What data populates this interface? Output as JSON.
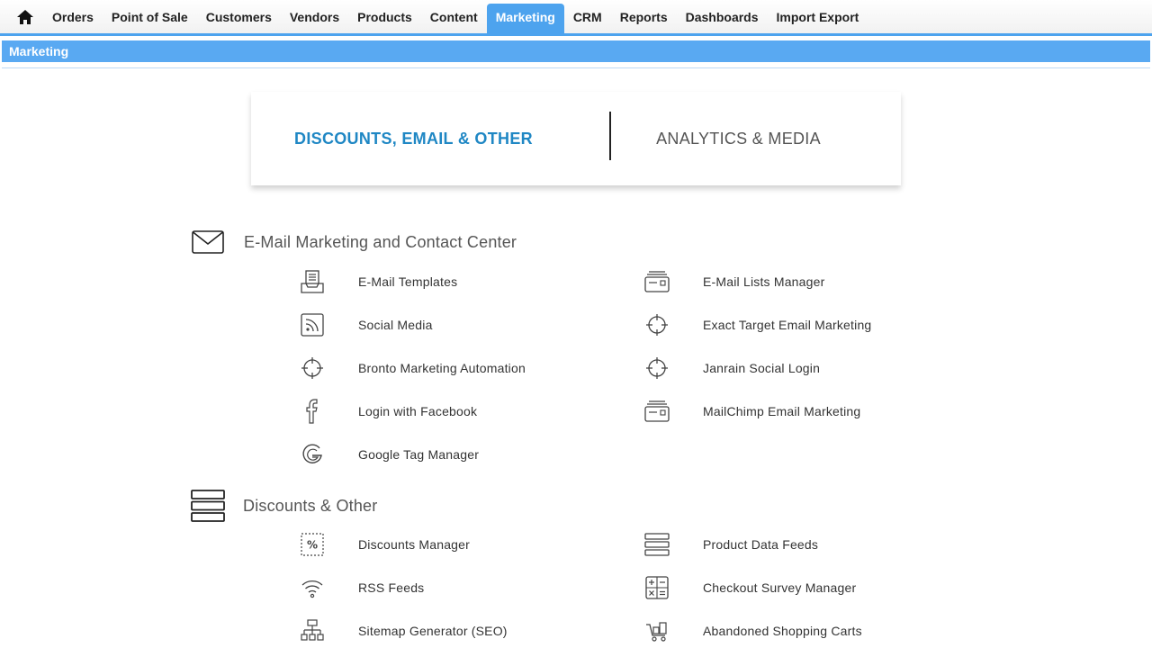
{
  "nav": {
    "items": [
      {
        "label": "Orders"
      },
      {
        "label": "Point of Sale"
      },
      {
        "label": "Customers"
      },
      {
        "label": "Vendors"
      },
      {
        "label": "Products"
      },
      {
        "label": "Content"
      },
      {
        "label": "Marketing",
        "active": true
      },
      {
        "label": "CRM"
      },
      {
        "label": "Reports"
      },
      {
        "label": "Dashboards"
      },
      {
        "label": "Import Export"
      }
    ],
    "home_icon": "home-icon",
    "accent": "#4da3ee"
  },
  "breadcrumb": {
    "title": "Marketing"
  },
  "tabs": {
    "active_label": "DISCOUNTS, EMAIL & OTHER",
    "other_label": "ANALYTICS & MEDIA",
    "active_color": "#1f87c4"
  },
  "sections": {
    "email": {
      "title": "E-Mail Marketing and Contact Center",
      "icon": "envelope-icon",
      "left": [
        {
          "label": "E-Mail Templates",
          "icon": "inbox-tray-icon"
        },
        {
          "label": "Social Media",
          "icon": "rss-icon"
        },
        {
          "label": "Bronto Marketing Automation",
          "icon": "crosshair-icon"
        },
        {
          "label": "Login with Facebook",
          "icon": "facebook-icon"
        },
        {
          "label": "Google Tag Manager",
          "icon": "google-icon"
        }
      ],
      "right": [
        {
          "label": "E-Mail Lists Manager",
          "icon": "mail-stack-icon"
        },
        {
          "label": "Exact Target Email Marketing",
          "icon": "crosshair-icon"
        },
        {
          "label": "Janrain Social Login",
          "icon": "crosshair-icon"
        },
        {
          "label": "MailChimp Email Marketing",
          "icon": "mail-stack-icon"
        }
      ]
    },
    "discounts": {
      "title": "Discounts & Other",
      "icon": "stack-icon",
      "left": [
        {
          "label": "Discounts Manager",
          "icon": "percent-icon"
        },
        {
          "label": "RSS Feeds",
          "icon": "wifi-icon"
        },
        {
          "label": "Sitemap Generator (SEO)",
          "icon": "sitemap-icon"
        }
      ],
      "right": [
        {
          "label": "Product Data Feeds",
          "icon": "stack-icon"
        },
        {
          "label": "Checkout Survey Manager",
          "icon": "calculator-icon"
        },
        {
          "label": "Abandoned Shopping Carts",
          "icon": "cart-icon"
        }
      ]
    }
  }
}
